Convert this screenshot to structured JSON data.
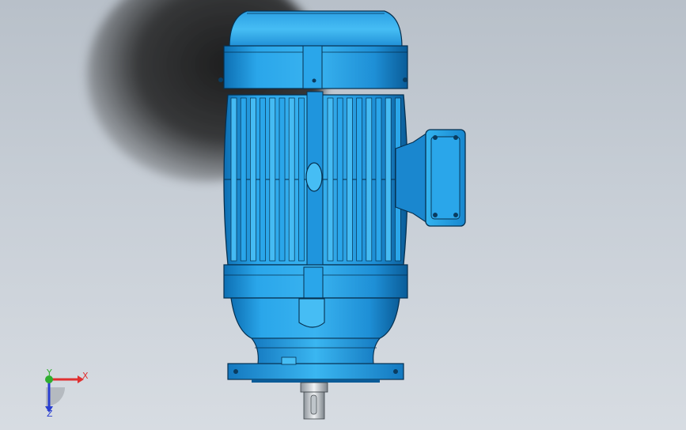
{
  "viewport": {
    "background_top": "#b8c0c9",
    "background_bottom": "#d7dce2"
  },
  "model": {
    "name_icon": "electric-motor-model",
    "body_color": "#1e96e0",
    "body_light": "#5cc3f5",
    "body_dark": "#0b5d9a",
    "edge_color": "#06304f"
  },
  "triad": {
    "x_label": "X",
    "y_label": "Y",
    "z_label": "Z",
    "x_color": "#e03030",
    "y_color": "#2fae2f",
    "z_color": "#2a3fd0"
  }
}
